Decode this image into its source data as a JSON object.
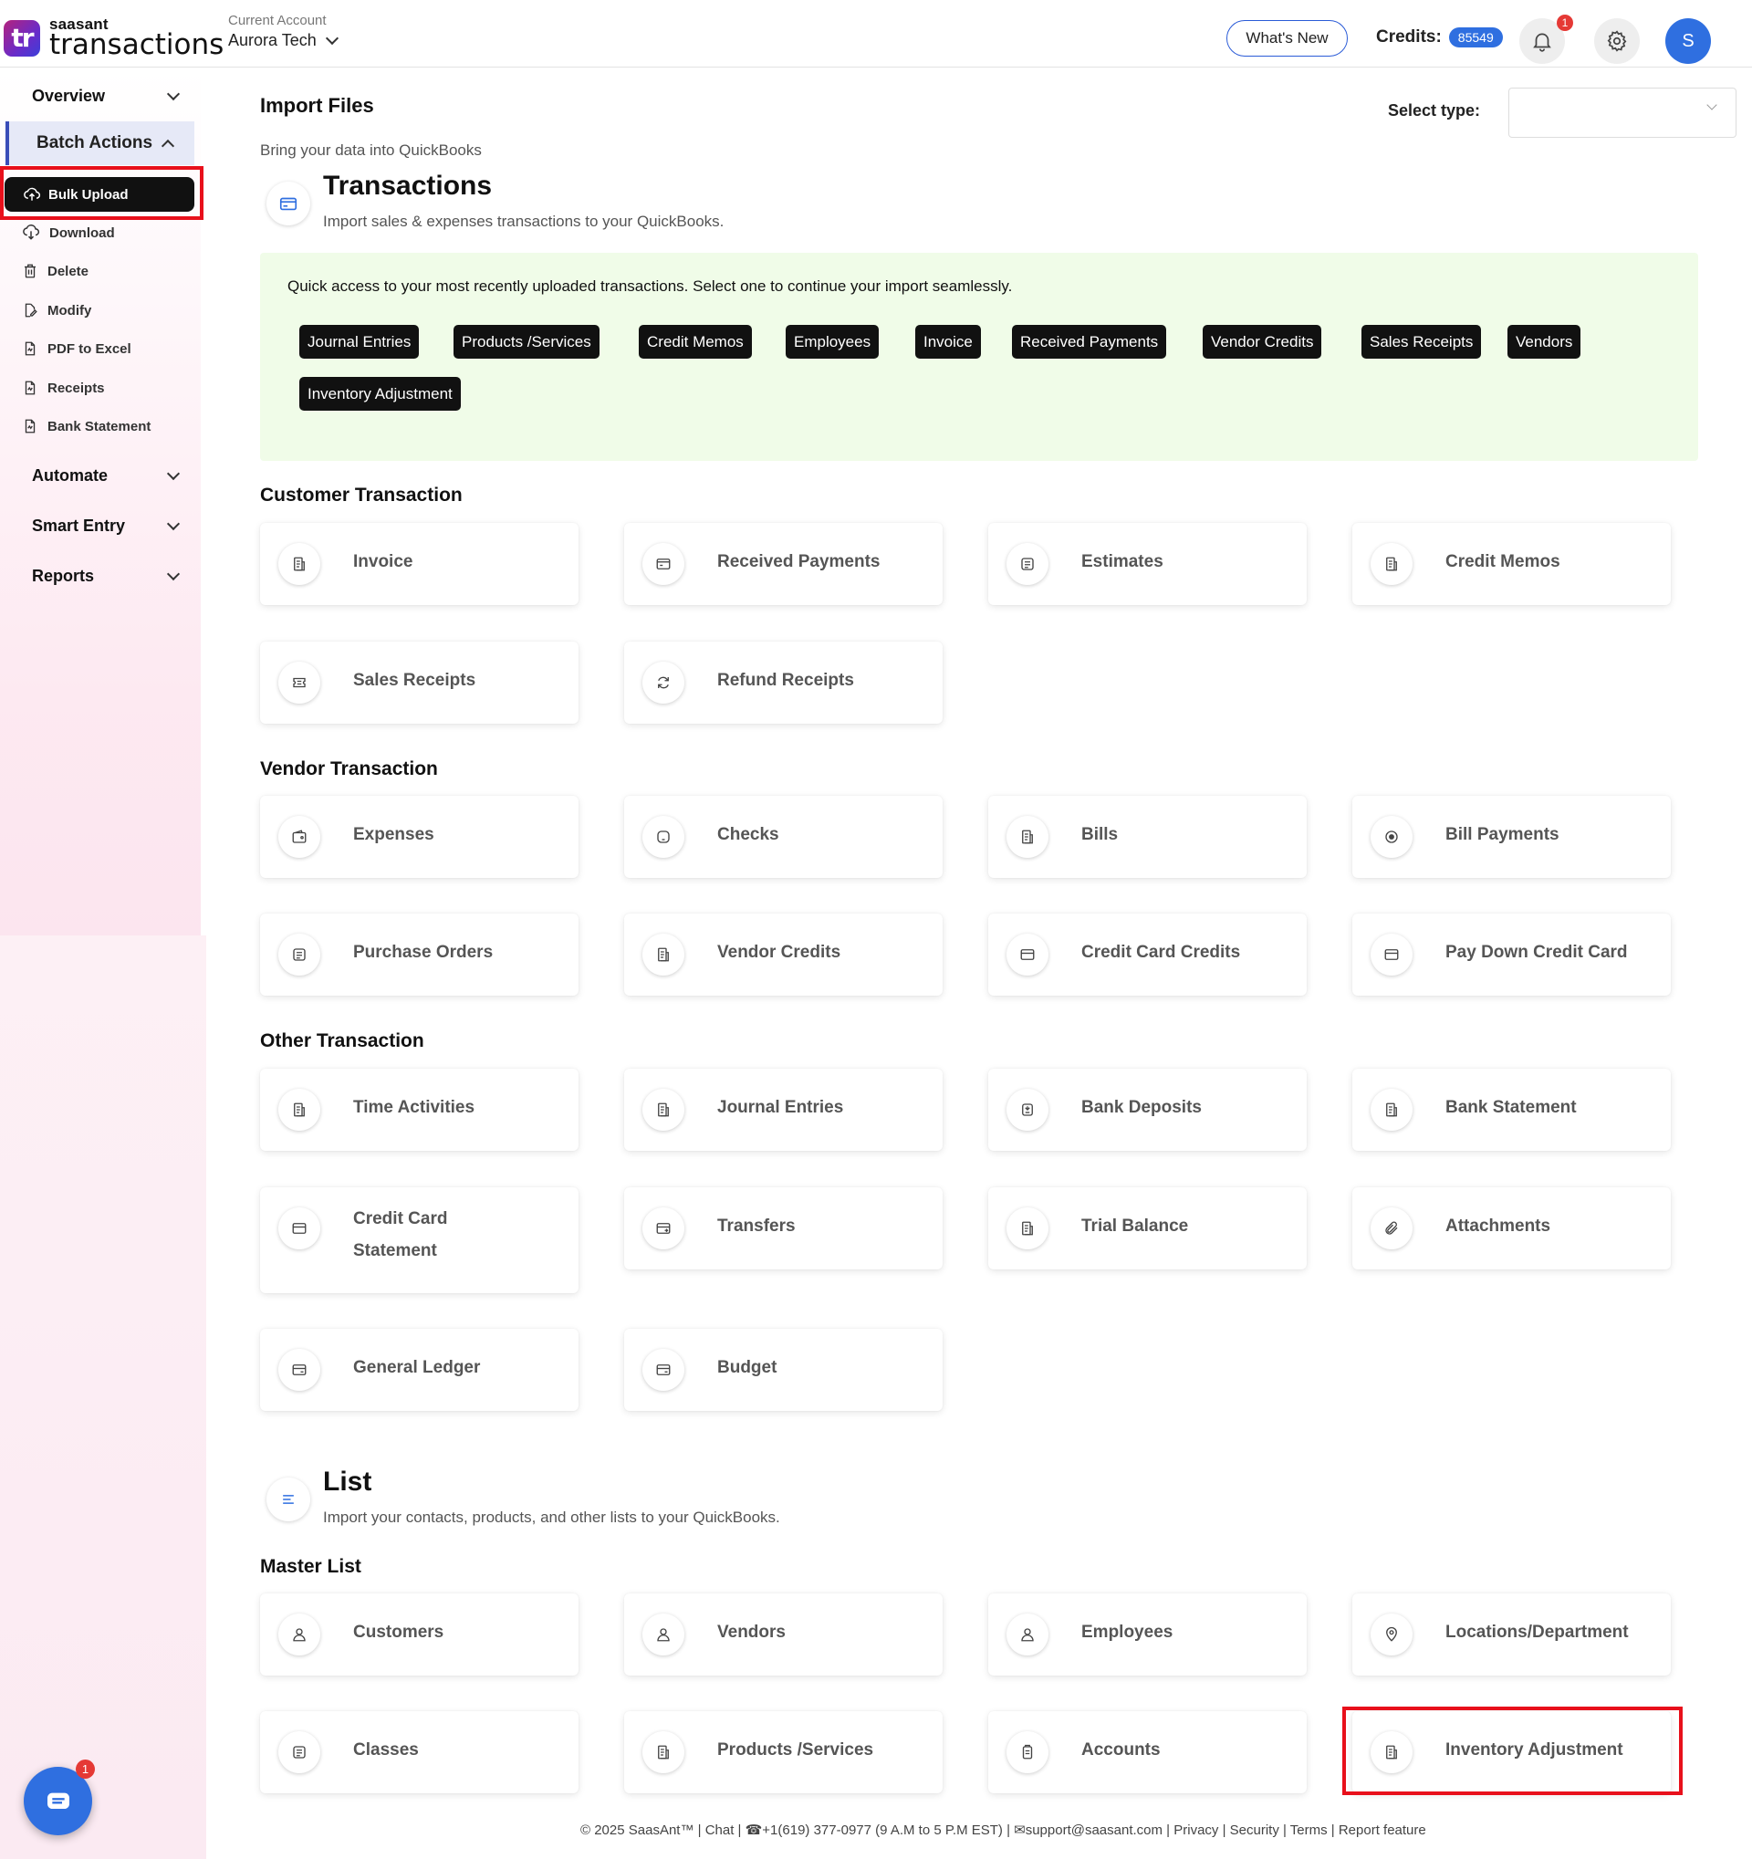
{
  "header": {
    "logo_small": "saasant",
    "logo_big": "transactions",
    "logo_mark": "tr",
    "account_label": "Current Account",
    "account_name": "Aurora Tech",
    "whats_new": "What's New",
    "credits_label": "Credits:",
    "credits_value": "85549",
    "notification_count": "1",
    "avatar_initial": "S"
  },
  "sidebar": {
    "overview": "Overview",
    "batch_actions": "Batch Actions",
    "items": [
      {
        "label": "Bulk Upload",
        "icon": "cloud-upload-icon"
      },
      {
        "label": "Download",
        "icon": "cloud-download-icon"
      },
      {
        "label": "Delete",
        "icon": "trash-icon"
      },
      {
        "label": "Modify",
        "icon": "edit-file-icon"
      },
      {
        "label": "PDF to Excel",
        "icon": "file-icon"
      },
      {
        "label": "Receipts",
        "icon": "file-icon"
      },
      {
        "label": "Bank Statement",
        "icon": "file-icon"
      }
    ],
    "automate": "Automate",
    "smart_entry": "Smart Entry",
    "reports": "Reports"
  },
  "main": {
    "title": "Import Files",
    "subtitle": "Bring your data into QuickBooks",
    "select_type_label": "Select type:",
    "select_type_value": "",
    "transactions": {
      "title": "Transactions",
      "desc": "Import sales & expenses transactions to your QuickBooks."
    },
    "quick_access": {
      "text": "Quick access to your most recently uploaded transactions. Select one to continue your import seamlessly.",
      "chips": [
        "Journal Entries",
        "Products /Services",
        "Credit Memos",
        "Employees",
        "Invoice",
        "Received Payments",
        "Vendor Credits",
        "Sales Receipts",
        "Vendors",
        "Inventory Adjustment"
      ]
    },
    "customer": {
      "title": "Customer Transaction",
      "cards": [
        "Invoice",
        "Received Payments",
        "Estimates",
        "Credit Memos",
        "Sales Receipts",
        "Refund Receipts"
      ]
    },
    "vendor": {
      "title": "Vendor Transaction",
      "cards": [
        "Expenses",
        "Checks",
        "Bills",
        "Bill Payments",
        "Purchase Orders",
        "Vendor Credits",
        "Credit Card Credits",
        "Pay Down Credit Card"
      ]
    },
    "other": {
      "title": "Other Transaction",
      "cards": [
        "Time Activities",
        "Journal Entries",
        "Bank Deposits",
        "Bank Statement",
        "Credit Card Statement",
        "Transfers",
        "Trial Balance",
        "Attachments",
        "General Ledger",
        "Budget"
      ]
    },
    "list": {
      "title": "List",
      "desc": "Import your contacts, products, and other lists to your QuickBooks."
    },
    "master": {
      "title": "Master List",
      "cards": [
        "Customers",
        "Vendors",
        "Employees",
        "Locations/Department",
        "Classes",
        "Products /Services",
        "Accounts",
        "Inventory Adjustment"
      ]
    }
  },
  "footer": {
    "text": "© 2025 SaasAnt™  | Chat  |  ☎+1(619) 377-0977 (9 A.M to 5 P.M EST)  |  ✉support@saasant.com  | Privacy  | Security  | Terms  | Report feature"
  },
  "chat_badge": "1",
  "colors": {
    "accent": "#2f6fe0",
    "highlight": "#e8101b",
    "quick_bg": "#f0fce8"
  }
}
